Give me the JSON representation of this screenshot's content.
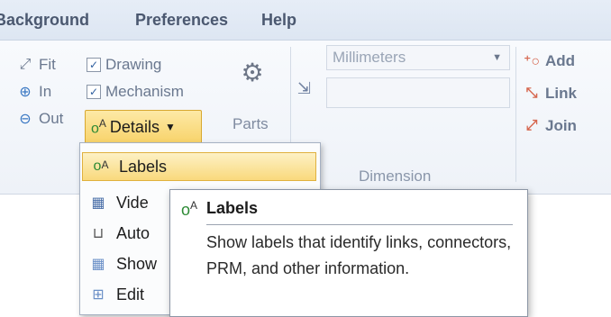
{
  "menubar": {
    "items": [
      "Background",
      "Preferences",
      "Help"
    ]
  },
  "ribbon": {
    "view_group": [
      "Fit",
      "In",
      "Out"
    ],
    "checks": [
      "Drawing",
      "Mechanism"
    ],
    "details_button": "Details",
    "parts_label": "Parts",
    "units_select": "Millimeters",
    "dimension_label": "Dimension",
    "link_group": [
      "Add",
      "Link",
      "Join"
    ]
  },
  "dropdown": {
    "items": [
      "Labels",
      "Vide",
      "Auto",
      "Show",
      "Edit"
    ]
  },
  "tooltip": {
    "title": "Labels",
    "body": "Show labels that identify links, connectors, PRM, and other information."
  }
}
